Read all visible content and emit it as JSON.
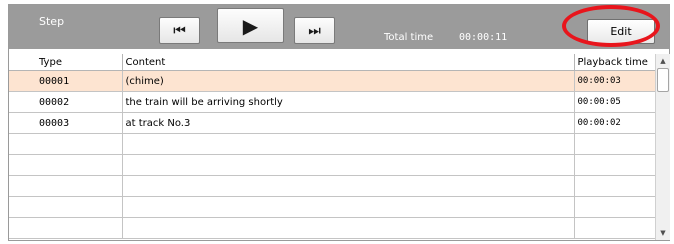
{
  "toolbar": {
    "step_label": "Step",
    "prev_icon": "skip-previous-icon",
    "play_icon": "play-icon",
    "next_icon": "skip-next-icon",
    "total_time_label": "Total time",
    "total_time_value": "00:00:11",
    "edit_label": "Edit"
  },
  "table": {
    "columns": [
      "Type",
      "Content",
      "Playback time"
    ],
    "selected_row": 0,
    "rows": [
      {
        "type": "00001",
        "content": "(chime)",
        "time": "00:00:03"
      },
      {
        "type": "00002",
        "content": "the train will be arriving shortly",
        "time": "00:00:05"
      },
      {
        "type": "00003",
        "content": "at track No.3",
        "time": "00:00:02"
      },
      {
        "type": "",
        "content": "",
        "time": ""
      },
      {
        "type": "",
        "content": "",
        "time": ""
      },
      {
        "type": "",
        "content": "",
        "time": ""
      },
      {
        "type": "",
        "content": "",
        "time": ""
      },
      {
        "type": "",
        "content": "",
        "time": ""
      }
    ]
  },
  "colors": {
    "toolbar_bg": "#9b9b9b",
    "selected_row_bg": "#fde4d1",
    "highlight_ring": "#e8151c"
  }
}
